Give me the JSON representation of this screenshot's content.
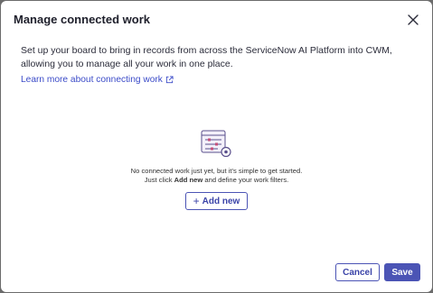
{
  "modal": {
    "title": "Manage connected work",
    "close_icon": "close-icon",
    "description": "Set up your board to bring in records from across the ServiceNow AI Platform into CWM, allowing you to manage all your work in one place.",
    "learn_more_link": "Learn more about connecting work",
    "learn_more_icon": "external-link-icon"
  },
  "empty_state": {
    "illustration_icon": "filter-settings-icon",
    "line1": "No connected work just yet, but it's simple to get started.",
    "line2_prefix": "Just click ",
    "line2_bold": "Add new",
    "line2_suffix": " and define your work filters.",
    "add_button_icon": "+",
    "add_button_label": "Add new"
  },
  "footer": {
    "cancel_label": "Cancel",
    "save_label": "Save"
  },
  "colors": {
    "accent": "#4b54b5",
    "link": "#3b4bc8",
    "backdrop": "#6b6b6b"
  }
}
